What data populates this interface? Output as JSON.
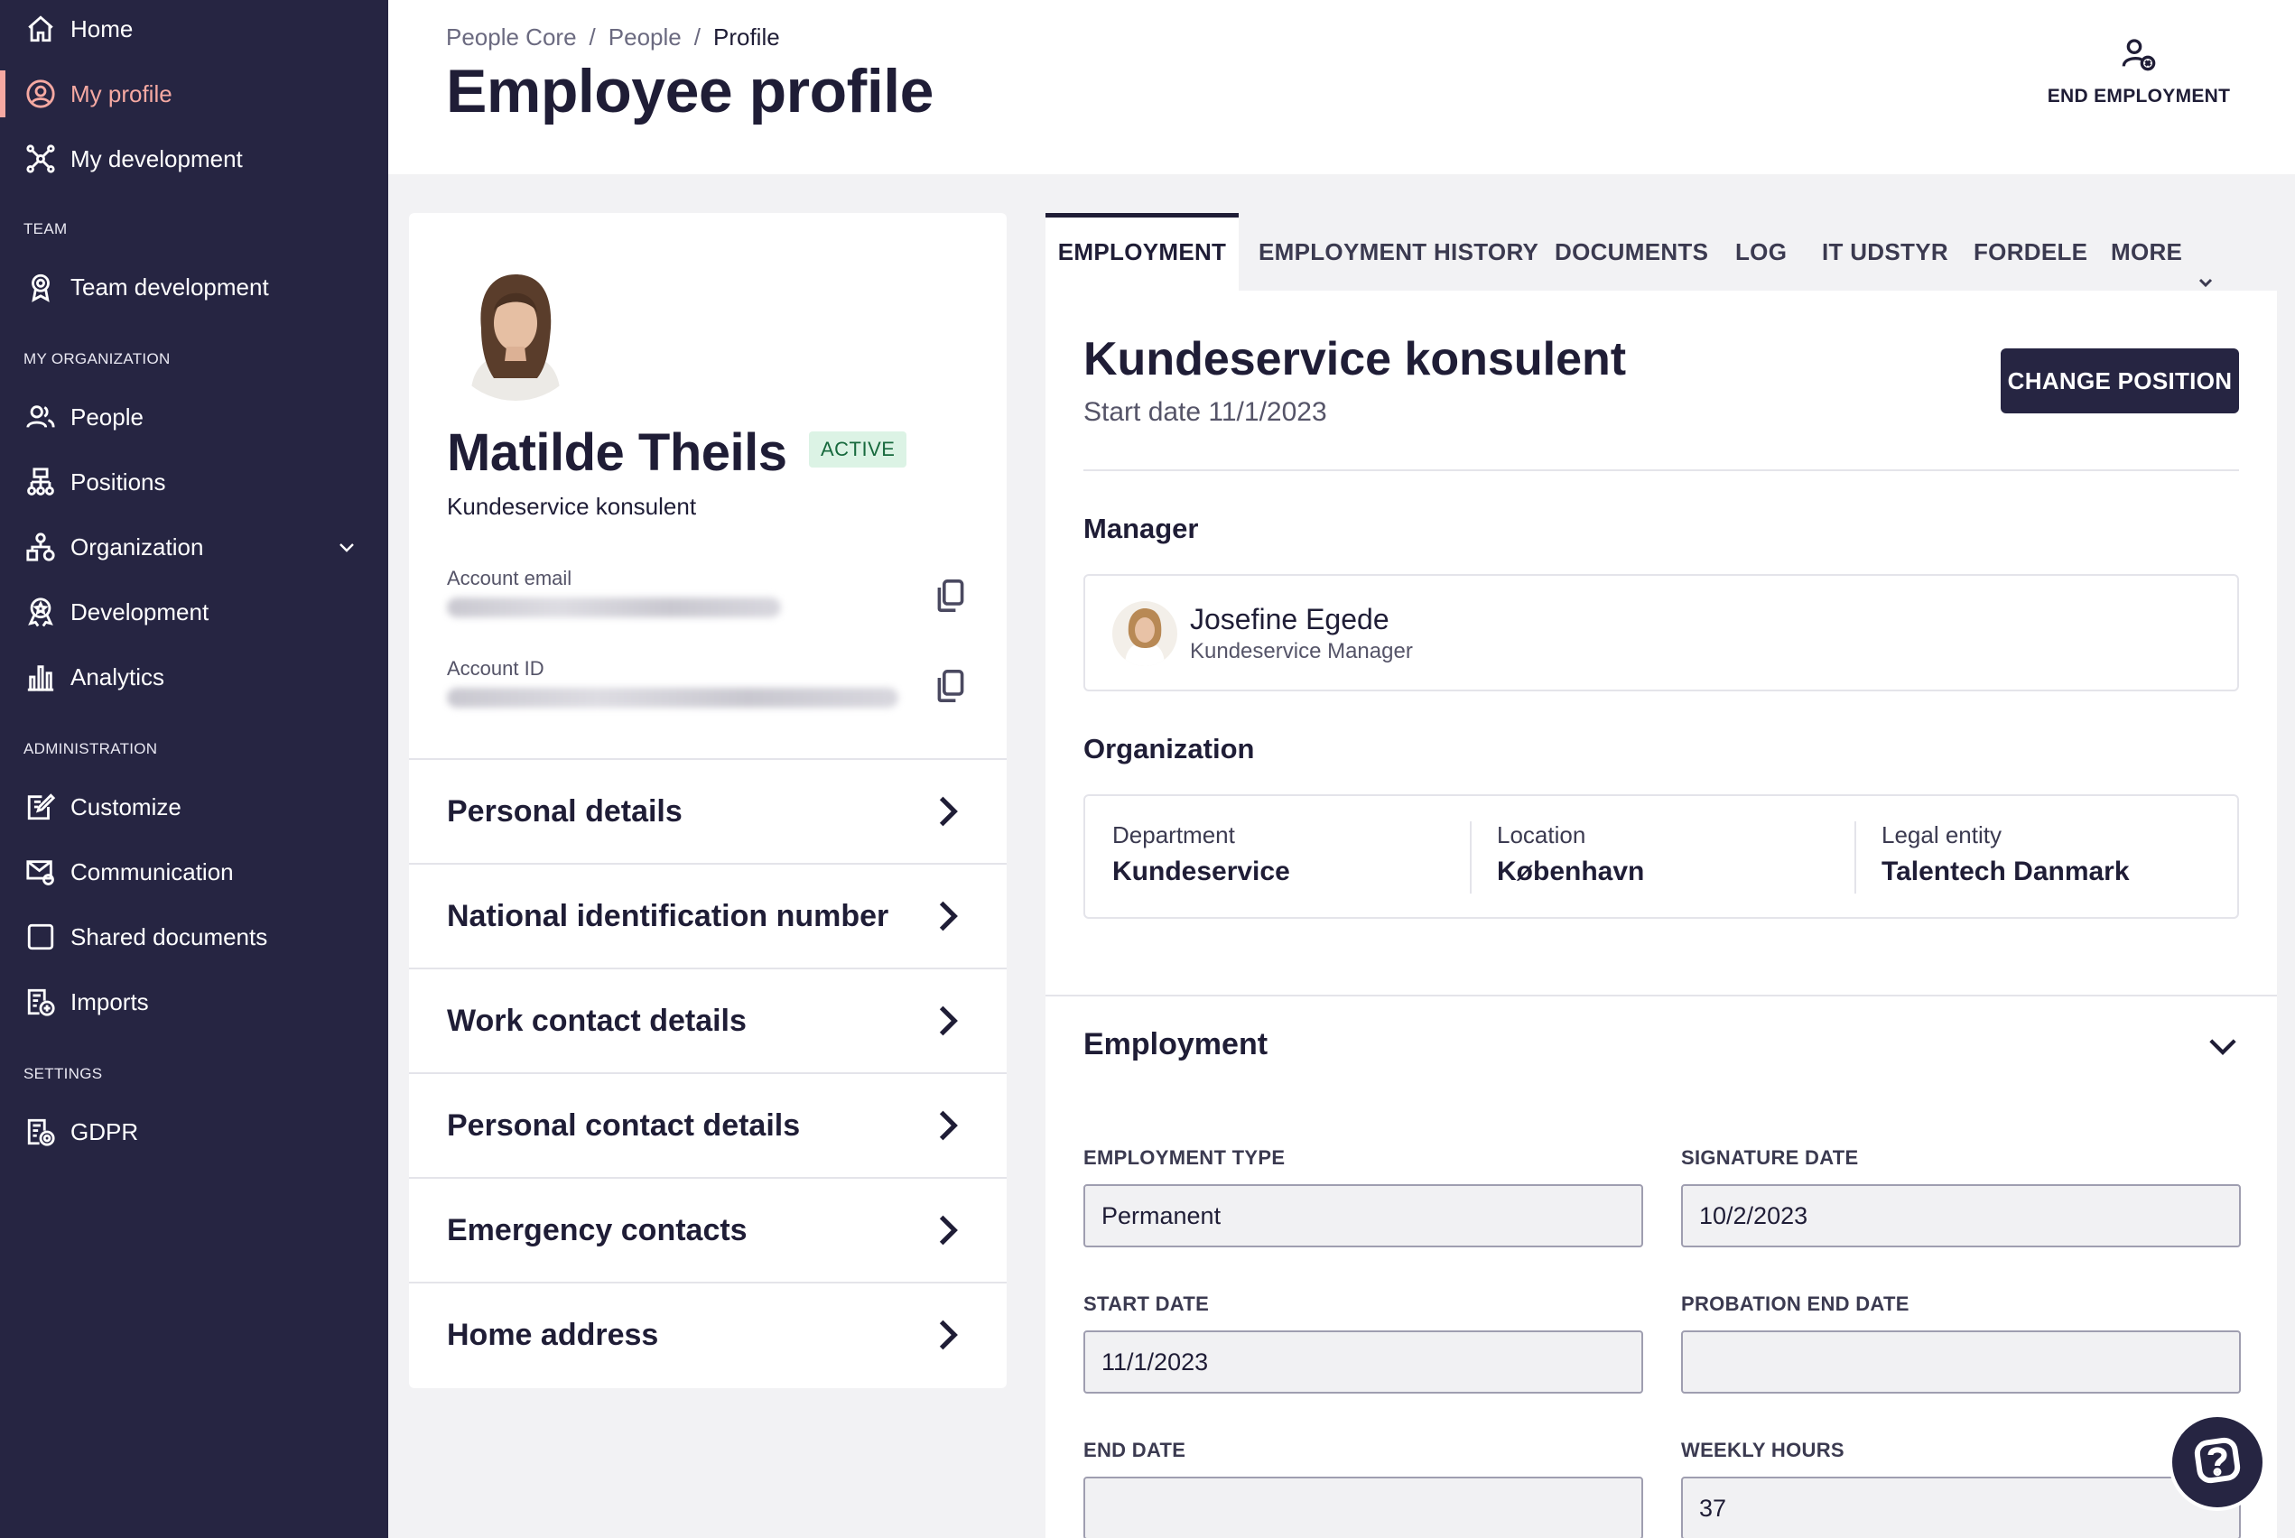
{
  "sidebar": {
    "items": [
      {
        "label": "Home"
      },
      {
        "label": "My profile"
      },
      {
        "label": "My development"
      },
      {
        "label": "Team development"
      },
      {
        "label": "People"
      },
      {
        "label": "Positions"
      },
      {
        "label": "Organization"
      },
      {
        "label": "Development"
      },
      {
        "label": "Analytics"
      },
      {
        "label": "Customize"
      },
      {
        "label": "Communication"
      },
      {
        "label": "Shared documents"
      },
      {
        "label": "Imports"
      },
      {
        "label": "GDPR"
      }
    ],
    "sections": {
      "team": "TEAM",
      "my_org": "MY ORGANIZATION",
      "admin": "ADMINISTRATION",
      "settings": "SETTINGS"
    },
    "active_color": "#f6a9a2",
    "bg_color": "#262542"
  },
  "header": {
    "breadcrumb": [
      "People Core",
      "People",
      "Profile"
    ],
    "separator": "/",
    "title": "Employee profile",
    "end_employment_label": "END EMPLOYMENT"
  },
  "profile": {
    "name": "Matilde Theils",
    "status": "ACTIVE",
    "role": "Kundeservice konsulent",
    "account_email_label": "Account email",
    "account_id_label": "Account ID",
    "sections": [
      "Personal details",
      "National identification number",
      "Work contact details",
      "Personal contact details",
      "Emergency contacts",
      "Home address"
    ]
  },
  "tabs": [
    {
      "label": "EMPLOYMENT"
    },
    {
      "label": "EMPLOYMENT HISTORY"
    },
    {
      "label": "DOCUMENTS"
    },
    {
      "label": "LOG"
    },
    {
      "label": "IT UDSTYR"
    },
    {
      "label": "FORDELE"
    },
    {
      "label": "MORE"
    }
  ],
  "position": {
    "title": "Kundeservice konsulent",
    "start_date": "Start date 11/1/2023",
    "change_button": "CHANGE POSITION"
  },
  "manager": {
    "heading": "Manager",
    "name": "Josefine Egede",
    "role": "Kundeservice Manager"
  },
  "organization": {
    "heading": "Organization",
    "department_label": "Department",
    "department": "Kundeservice",
    "location_label": "Location",
    "location": "København",
    "legal_entity_label": "Legal entity",
    "legal_entity": "Talentech Danmark"
  },
  "employment": {
    "heading": "Employment",
    "fields": {
      "employment_type": {
        "label": "EMPLOYMENT TYPE",
        "value": "Permanent"
      },
      "signature_date": {
        "label": "SIGNATURE DATE",
        "value": "10/2/2023"
      },
      "start_date": {
        "label": "START DATE",
        "value": "11/1/2023"
      },
      "probation_end_date": {
        "label": "PROBATION END DATE",
        "value": ""
      },
      "end_date": {
        "label": "END DATE",
        "value": ""
      },
      "weekly_hours": {
        "label": "WEEKLY HOURS",
        "value": "37"
      }
    }
  },
  "icons": {
    "home": "home-icon",
    "profile": "user-circle-icon",
    "development": "network-icon",
    "team_development": "award-icon",
    "people": "users-icon",
    "positions": "hierarchy-icon",
    "organization": "org-chart-icon",
    "dev": "medal-icon",
    "analytics": "bar-chart-icon",
    "customize": "edit-icon",
    "communication": "mail-gear-icon",
    "shared_documents": "square-icon",
    "imports": "document-plus-icon",
    "gdpr": "document-gear-icon",
    "copy": "copy-icon",
    "chevron_right": "chevron-right-icon",
    "chevron_down": "chevron-down-icon",
    "end_employment": "user-remove-icon",
    "help": "help-chat-icon"
  }
}
